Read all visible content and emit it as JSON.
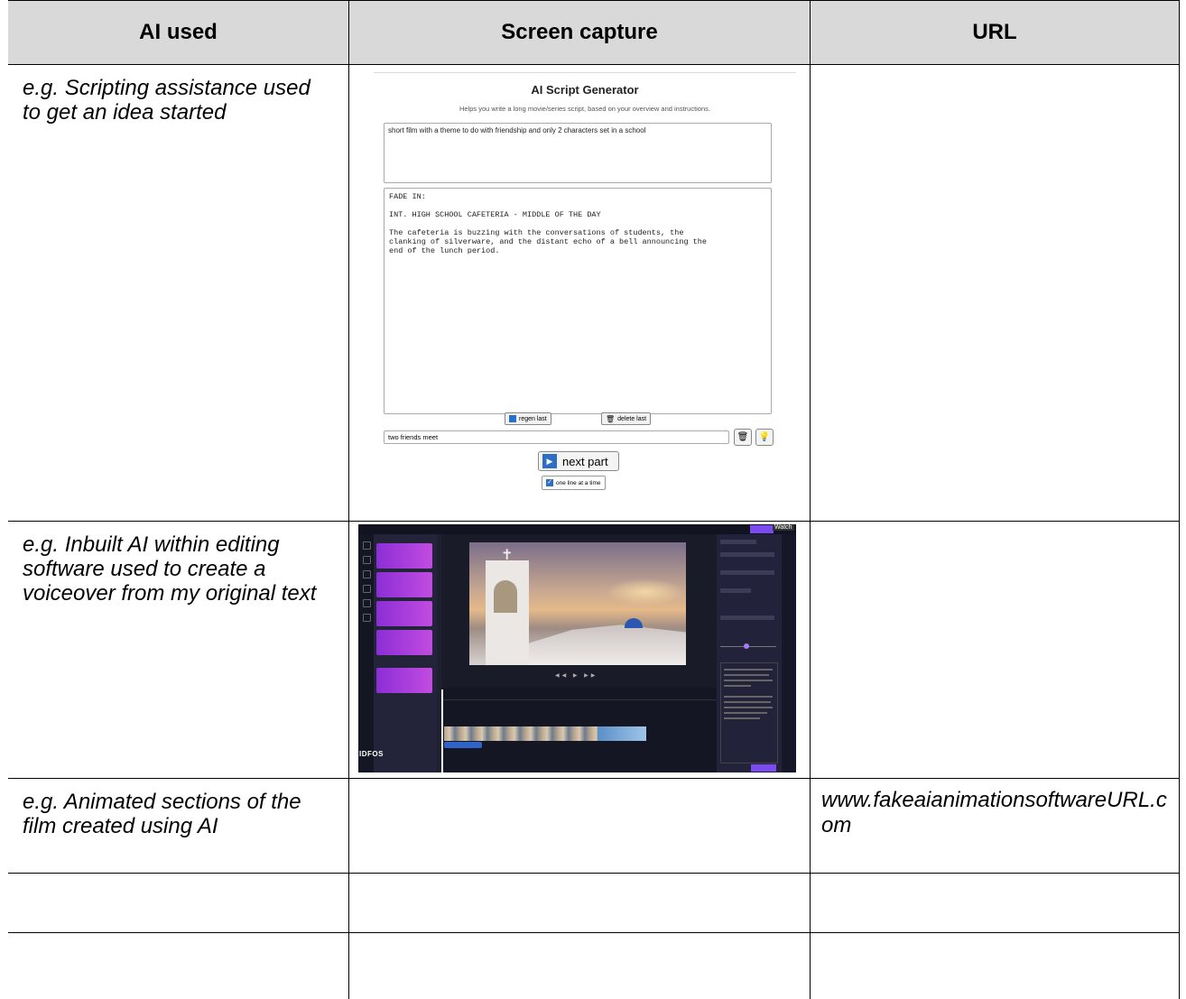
{
  "headers": [
    "AI used",
    "Screen capture",
    "URL"
  ],
  "rows": [
    {
      "ai_used": "e.g. Scripting assistance used to get an idea started",
      "url": ""
    },
    {
      "ai_used": "e.g. Inbuilt AI within editing software used to create a voiceover from my original text",
      "url": ""
    },
    {
      "ai_used": "e.g. Animated sections of the film created using AI",
      "url": "www.fakeaianimationsoftwareURL.com"
    },
    {
      "ai_used": "",
      "url": ""
    },
    {
      "ai_used": "",
      "url": ""
    }
  ],
  "script_generator": {
    "title": "AI Script Generator",
    "subtitle": "Helps you write a long movie/series script, based on your overview and instructions.",
    "overview": "short film with a theme to do with friendship and only 2 characters set in a school",
    "output": "FADE IN:\n\nINT. HIGH SCHOOL CAFETERIA - MIDDLE OF THE DAY\n\nThe cafeteria is buzzing with the conversations of students, the\nclanking of silverware, and the distant echo of a bell announcing the\nend of the lunch period.",
    "regen_label": "regen last",
    "delete_label": "delete last",
    "instruction": "two friends meet",
    "next_label": "next part",
    "checkbox_label": "one line at a time",
    "accent": "#2d6fc2"
  },
  "video_editor": {
    "watermark": "Watch",
    "logo": "IDFOS",
    "accent": "#7a4cf0"
  }
}
